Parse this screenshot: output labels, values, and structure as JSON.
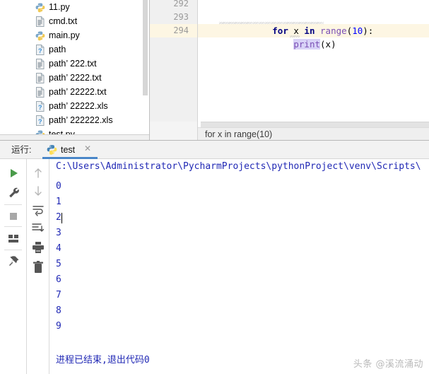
{
  "project_tree": {
    "name": "project-file-tree",
    "files": [
      {
        "label": "11.py",
        "icon": "python-file-icon"
      },
      {
        "label": "cmd.txt",
        "icon": "text-file-icon"
      },
      {
        "label": "main.py",
        "icon": "python-file-icon"
      },
      {
        "label": "path",
        "icon": "unknown-file-icon"
      },
      {
        "label": "path’ 222.txt",
        "icon": "text-file-icon"
      },
      {
        "label": "path’ 2222.txt",
        "icon": "text-file-icon"
      },
      {
        "label": "path’ 22222.txt",
        "icon": "text-file-icon"
      },
      {
        "label": "path’ 22222.xls",
        "icon": "unknown-file-icon"
      },
      {
        "label": "path’ 222222.xls",
        "icon": "unknown-file-icon"
      },
      {
        "label": "test.py",
        "icon": "python-file-icon"
      }
    ]
  },
  "editor": {
    "gutter": [
      "292",
      "293",
      "294"
    ],
    "highlighted_line": "294",
    "lines": [
      {
        "number": "293",
        "tokens": [
          {
            "text": "for",
            "kind": "kw"
          },
          {
            "text": " x ",
            "kind": "plain"
          },
          {
            "text": "in",
            "kind": "kw"
          },
          {
            "text": " ",
            "kind": "plain"
          },
          {
            "text": "range",
            "kind": "fn"
          },
          {
            "text": "(",
            "kind": "plain"
          },
          {
            "text": "10",
            "kind": "num"
          },
          {
            "text": "):",
            "kind": "plain"
          }
        ]
      },
      {
        "number": "294",
        "tokens": [
          {
            "text": "    ",
            "kind": "plain"
          },
          {
            "text": "print",
            "kind": "fn-sel"
          },
          {
            "text": "(x)",
            "kind": "plain"
          }
        ]
      }
    ],
    "line_293_text": "for x in range(10):",
    "line_294_text": "    print(x)",
    "breadcrumb": "for x in range(10)"
  },
  "run_panel": {
    "label": "运行:",
    "tab": {
      "label": "test",
      "icon": "python-file-icon",
      "close": "✕"
    },
    "toolbar_left": [
      {
        "name": "rerun-button",
        "icon": "play-icon"
      },
      {
        "name": "edit-configuration-button",
        "icon": "wrench-icon"
      },
      {
        "name": "stop-button",
        "icon": "stop-square-icon"
      },
      {
        "name": "layout-settings-button",
        "icon": "layout-icon"
      },
      {
        "name": "pin-tab-button",
        "icon": "pin-icon"
      }
    ],
    "toolbar_right": [
      {
        "name": "up-the-stack-trace-button",
        "icon": "arrow-up-icon"
      },
      {
        "name": "down-the-stack-trace-button",
        "icon": "arrow-down-icon"
      },
      {
        "name": "soft-wrap-button",
        "icon": "soft-wrap-icon"
      },
      {
        "name": "scroll-to-end-button",
        "icon": "scroll-to-end-icon"
      },
      {
        "name": "print-button",
        "icon": "printer-icon"
      },
      {
        "name": "clear-all-button",
        "icon": "trash-icon"
      }
    ],
    "console": {
      "command_line": "C:\\Users\\Administrator\\PycharmProjects\\pythonProject\\venv\\Scripts\\",
      "output": [
        "0",
        "1",
        "2",
        "3",
        "4",
        "5",
        "6",
        "7",
        "8",
        "9"
      ],
      "caret_after_line": "2",
      "exit_message": "进程已结束,退出代码0"
    }
  },
  "watermark": {
    "text": "头条 @溪流涌动"
  },
  "colors": {
    "keyword": "#000080",
    "function": "#7a4fb5",
    "number": "#0000ff",
    "selection": "#d8d2f7",
    "current_line": "#fdf6e3",
    "tab_underline": "#4a86c8",
    "console_text": "#2129b5",
    "run_icon_green": "#4a9b4a"
  }
}
